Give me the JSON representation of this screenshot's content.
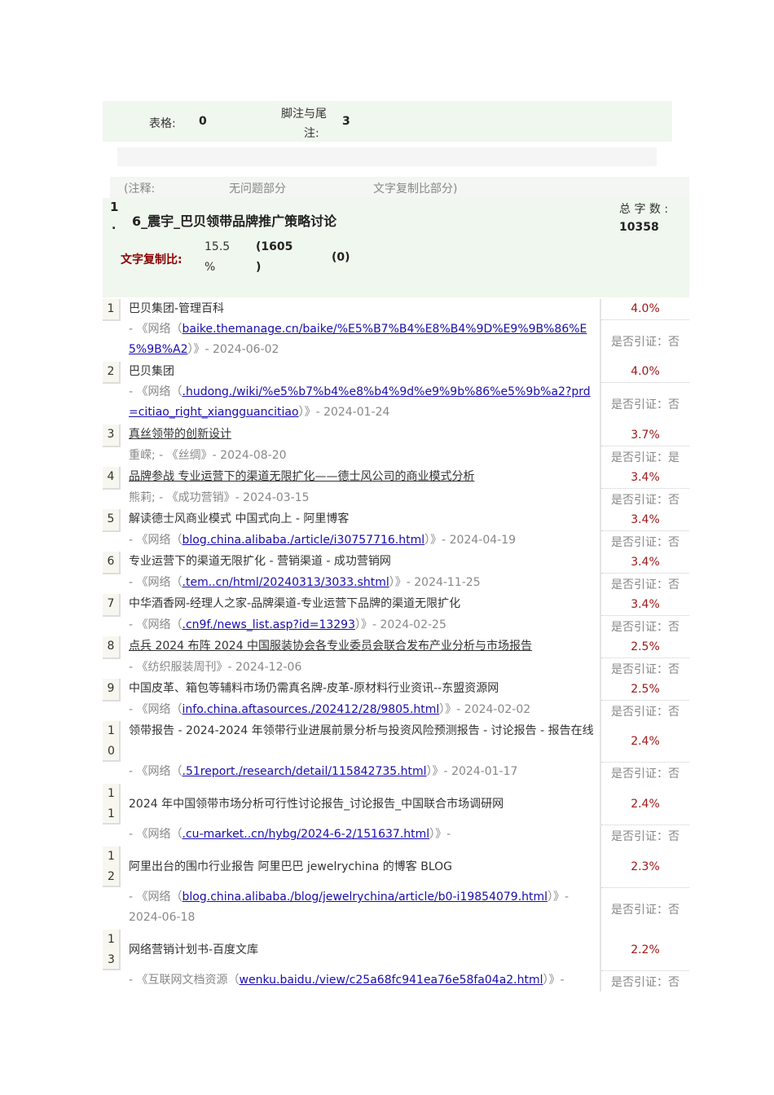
{
  "stats": {
    "tables_label": "表格:",
    "tables_value": "0",
    "footnotes_label_1": "脚注与尾",
    "footnotes_label_2": "注:",
    "footnotes_value": "3"
  },
  "legend": {
    "note": "(注释:",
    "ok": "无问题部分",
    "copied": "文字复制比部分)"
  },
  "doc": {
    "index": "1",
    "dot": ".",
    "title": "6_震宇_巴贝领带品牌推广策略讨论",
    "total_label": "总 字 数 :",
    "total_value": "10358",
    "ratio_label": "文字复制比:",
    "ratio_value_1": "15.5",
    "ratio_value_2": "%",
    "count_1": "(1605",
    "count_2": ")",
    "count_zero": "(0)"
  },
  "colors": {
    "accent": "#a01818",
    "bg": "#f0f7ee",
    "link": "#1a0dab"
  },
  "results": [
    {
      "num": "1",
      "title": "巴贝集团-管理百科",
      "underline": false,
      "pre": "- 《网络（",
      "link": "baike.themanage.cn/baike/%E5%B7%B4%E8%B4%9D%E9%9B%86%E5%9B%A2",
      "post": "）》- 2024-06-02",
      "pct": "4.0%",
      "cite": "是否引证：否"
    },
    {
      "num": "2",
      "title": "巴贝集团",
      "underline": false,
      "pre": "- 《网络（",
      "link": ".hudong./wiki/%e5%b7%b4%e8%b4%9d%e9%9b%86%e5%9b%a2?prd=citiao_right_xiangguancitiao",
      "post": "）》- 2024-01-24",
      "pct": "4.0%",
      "cite": "是否引证：否"
    },
    {
      "num": "3",
      "title": "真丝领带的创新设计",
      "underline": true,
      "pre": "重嵘; - 《丝绸》- 2024-08-20",
      "link": "",
      "post": "",
      "pct": "3.7%",
      "cite": "是否引证：是"
    },
    {
      "num": "4",
      "title": "品牌参战 专业运营下的渠道无限扩化——德士风公司的商业模式分析",
      "underline": true,
      "pre": "熊莉; - 《成功营销》- 2024-03-15",
      "link": "",
      "post": "",
      "pct": "3.4%",
      "cite": "是否引证：否"
    },
    {
      "num": "5",
      "title": "解读德士风商业模式 中国式向上 - 阿里博客",
      "underline": false,
      "pre": "- 《网络（",
      "link": "blog.china.alibaba./article/i30757716.html",
      "post": "）》- 2024-04-19",
      "pct": "3.4%",
      "cite": "是否引证：否"
    },
    {
      "num": "6",
      "title": "专业运营下的渠道无限扩化 - 营销渠道 - 成功营销网",
      "underline": false,
      "pre": "- 《网络（",
      "link": ".tem..cn/html/20240313/3033.shtml",
      "post": "）》- 2024-11-25",
      "pct": "3.4%",
      "cite": "是否引证：否"
    },
    {
      "num": "7",
      "title": "中华酒香网-经理人之家-品牌渠道-专业运营下品牌的渠道无限扩化",
      "underline": false,
      "pre": "- 《网络（",
      "link": ".cn9f./news_list.asp?id=13293",
      "post": "）》- 2024-02-25",
      "pct": "3.4%",
      "cite": "是否引证：否"
    },
    {
      "num": "8",
      "title": "点兵 2024 布阵 2024 中国服装协会各专业委员会联合发布产业分析与市场报告",
      "underline": true,
      "pre": "- 《纺织服装周刊》- 2024-12-06",
      "link": "",
      "post": "",
      "pct": "2.5%",
      "cite": "是否引证：否"
    },
    {
      "num": "9",
      "title": "中国皮革、箱包等辅料市场仍需真名牌-皮革-原材料行业资讯--东盟资源网",
      "underline": false,
      "pre": "- 《网络（",
      "link": "info.china.aftasources./202412/28/9805.html",
      "post": "）》- 2024-02-02",
      "pct": "2.5%",
      "cite": "是否引证：否"
    },
    {
      "num": "10",
      "title": "领带报告 - 2024-2024 年领带行业进展前景分析与投资风险预测报告 - 讨论报告 - 报告在线",
      "underline": false,
      "pre": "- 《网络（",
      "link": ".51report./research/detail/115842735.html",
      "post": "）》- 2024-01-17",
      "pct": "2.4%",
      "cite": "是否引证：否"
    },
    {
      "num": "11",
      "title": "2024 年中国领带市场分析可行性讨论报告_讨论报告_中国联合市场调研网",
      "underline": false,
      "pre": "- 《网络（",
      "link": ".cu-market..cn/hybg/2024-6-2/151637.html",
      "post": "）》-",
      "pct": "2.4%",
      "cite": "是否引证：否"
    },
    {
      "num": "12",
      "title": "阿里出台的围巾行业报告 阿里巴巴 jewelrychina 的博客 BLOG",
      "underline": false,
      "pre": "- 《网络（",
      "link": "blog.china.alibaba./blog/jewelrychina/article/b0-i19854079.html",
      "post": "）》- 2024-06-18",
      "pct": "2.3%",
      "cite": "是否引证：否"
    },
    {
      "num": "13",
      "title": "网络营销计划书-百度文库",
      "underline": false,
      "pre": "- 《互联网文档资源（",
      "link": "wenku.baidu./view/c25a68fc941ea76e58fa04a2.html",
      "post": "）》-",
      "pct": "2.2%",
      "cite": "是否引证：否"
    }
  ]
}
